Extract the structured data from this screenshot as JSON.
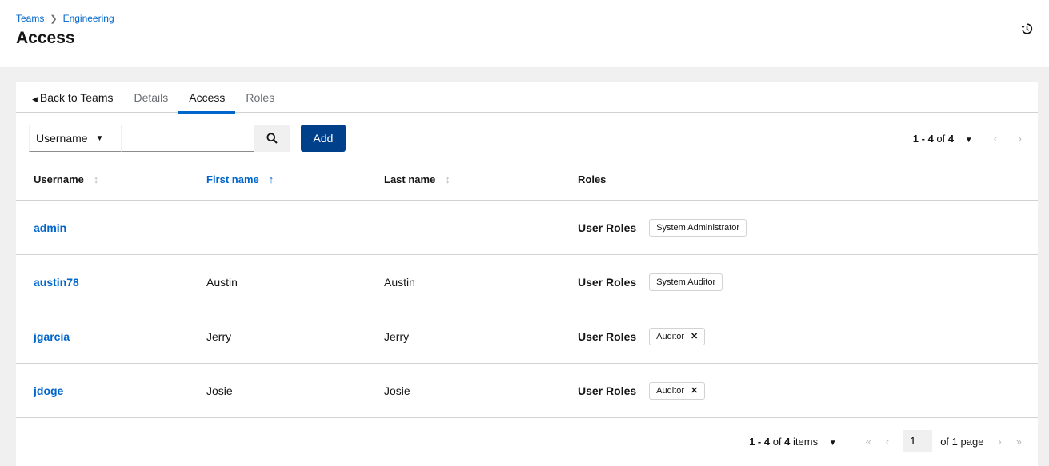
{
  "header": {
    "breadcrumb": [
      {
        "label": "Teams"
      },
      {
        "label": "Engineering"
      }
    ],
    "title": "Access"
  },
  "tabs": [
    {
      "label": "Back to Teams"
    },
    {
      "label": "Details"
    },
    {
      "label": "Access"
    },
    {
      "label": "Roles"
    }
  ],
  "toolbar": {
    "filter_field": "Username",
    "search_value": "",
    "add_label": "Add",
    "top_pager": {
      "range": "1 - 4",
      "of_label": "of",
      "total": "4"
    }
  },
  "table": {
    "columns": [
      "Username",
      "First name",
      "Last name",
      "Roles"
    ],
    "rows": [
      {
        "username": "admin",
        "first_name": "",
        "last_name": "",
        "role_group": "User Roles",
        "role": "System Administrator"
      },
      {
        "username": "austin78",
        "first_name": "Austin",
        "last_name": "Austin",
        "role_group": "User Roles",
        "role": "System Auditor"
      },
      {
        "username": "jgarcia",
        "first_name": "Jerry",
        "last_name": "Jerry",
        "role_group": "User Roles",
        "role": "Auditor"
      },
      {
        "username": "jdoge",
        "first_name": "Josie",
        "last_name": "Josie",
        "role_group": "User Roles",
        "role": "Auditor"
      }
    ]
  },
  "bottom_pager": {
    "range": "1 - 4",
    "of_label": "of",
    "total": "4",
    "items_label": "items",
    "page": "1",
    "of_pages": "of 1 page"
  },
  "icons": {
    "history": "history-icon",
    "search": "search-icon",
    "sort": "sort-icon",
    "close": "close-icon"
  },
  "colors": {
    "link": "#0066cc",
    "primary_button": "#003f8a",
    "tab_active": "#0066cc"
  }
}
